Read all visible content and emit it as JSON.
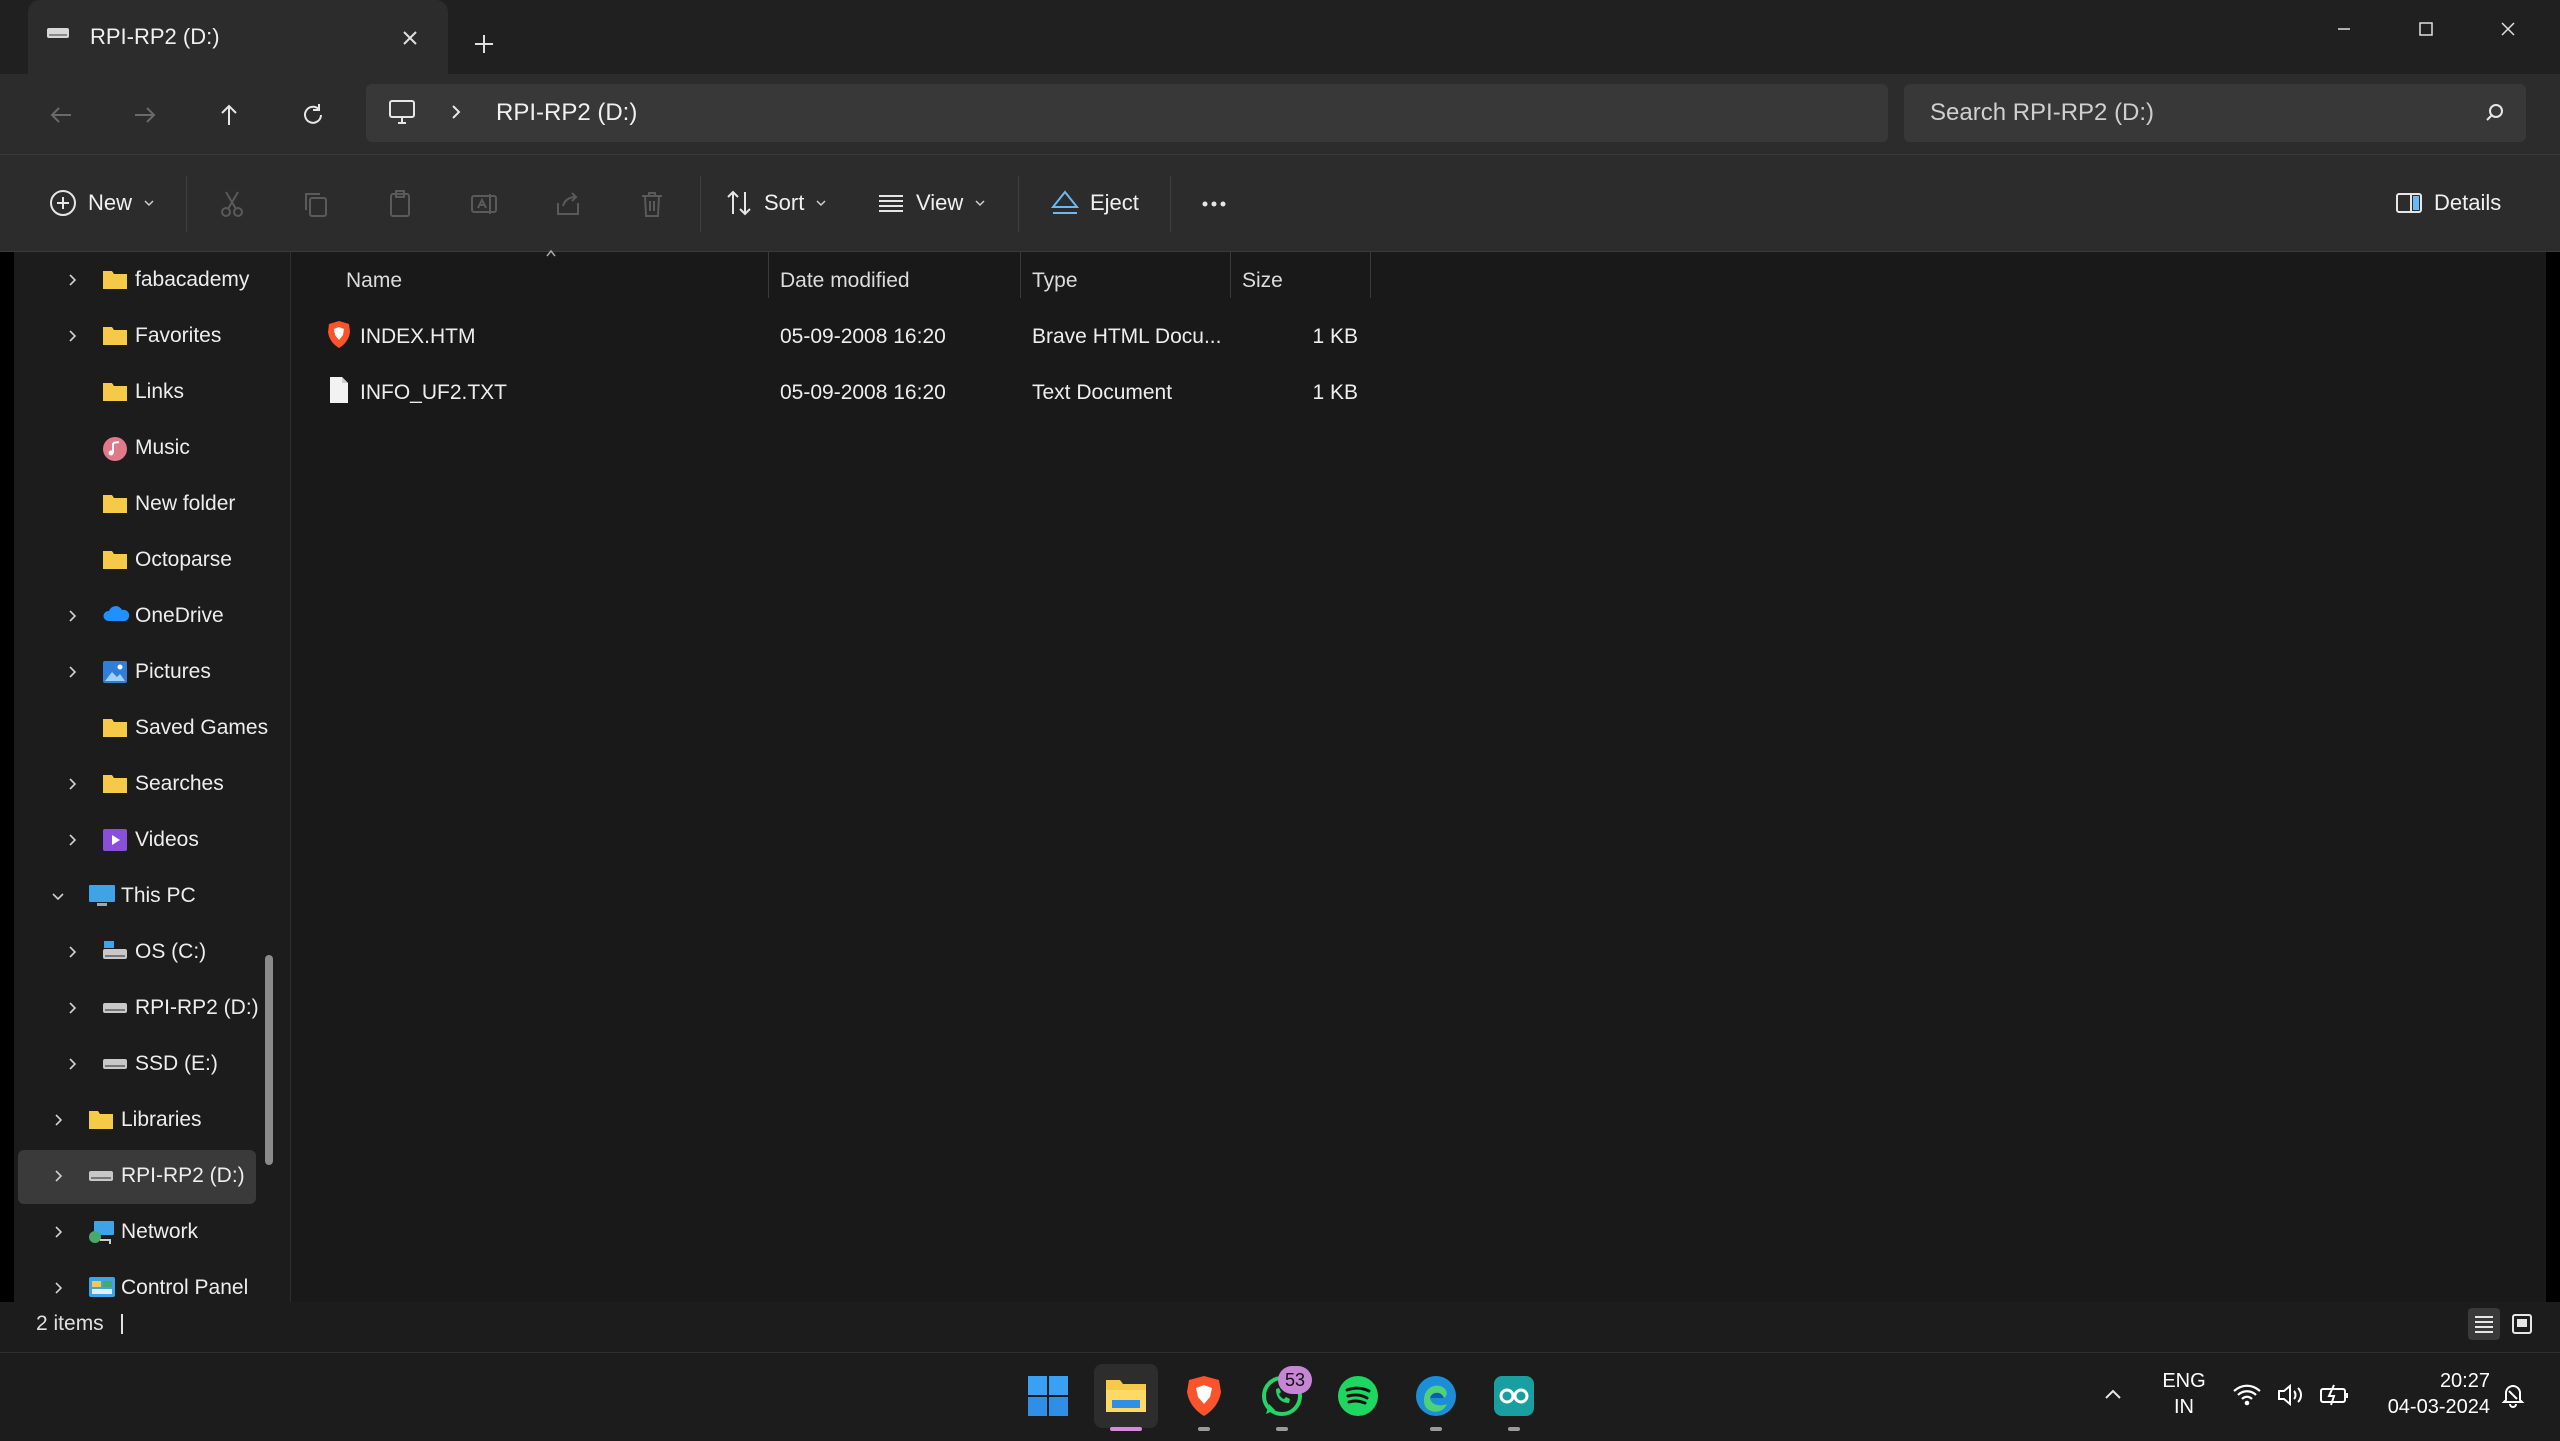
{
  "window": {
    "tab_title": "RPI-RP2 (D:)"
  },
  "address_bar": {
    "path": "RPI-RP2 (D:)",
    "search_placeholder": "Search RPI-RP2 (D:)"
  },
  "toolbar": {
    "new_label": "New",
    "sort_label": "Sort",
    "view_label": "View",
    "eject_label": "Eject",
    "details_label": "Details"
  },
  "sidebar": {
    "items": [
      {
        "label": "fabacademy",
        "icon": "folder-icon",
        "expandable": true
      },
      {
        "label": "Favorites",
        "icon": "folder-icon",
        "expandable": true
      },
      {
        "label": "Links",
        "icon": "folder-icon",
        "expandable": false
      },
      {
        "label": "Music",
        "icon": "music-icon",
        "expandable": false
      },
      {
        "label": "New folder",
        "icon": "folder-icon",
        "expandable": false
      },
      {
        "label": "Octoparse",
        "icon": "folder-icon",
        "expandable": false
      },
      {
        "label": "OneDrive",
        "icon": "onedrive-icon",
        "expandable": true
      },
      {
        "label": "Pictures",
        "icon": "pictures-icon",
        "expandable": true
      },
      {
        "label": "Saved Games",
        "icon": "folder-icon",
        "expandable": false
      },
      {
        "label": "Searches",
        "icon": "folder-icon",
        "expandable": true
      },
      {
        "label": "Videos",
        "icon": "videos-icon",
        "expandable": true
      },
      {
        "label": "This PC",
        "icon": "this-pc-icon",
        "expandable": true,
        "expanded": true
      },
      {
        "label": "OS (C:)",
        "icon": "drive-icon",
        "expandable": true
      },
      {
        "label": "RPI-RP2 (D:)",
        "icon": "drive-icon",
        "expandable": true
      },
      {
        "label": "SSD (E:)",
        "icon": "drive-icon",
        "expandable": true
      },
      {
        "label": "Libraries",
        "icon": "folder-icon",
        "expandable": true
      },
      {
        "label": "RPI-RP2 (D:)",
        "icon": "drive-icon",
        "expandable": true,
        "selected": true
      },
      {
        "label": "Network",
        "icon": "network-icon",
        "expandable": true
      },
      {
        "label": "Control Panel",
        "icon": "control-panel-icon",
        "expandable": true
      }
    ]
  },
  "file_list": {
    "columns": [
      "Name",
      "Date modified",
      "Type",
      "Size"
    ],
    "rows": [
      {
        "name": "INDEX.HTM",
        "date": "05-09-2008 16:20",
        "type": "Brave HTML Docu...",
        "size": "1 KB",
        "icon": "brave-html-icon"
      },
      {
        "name": "INFO_UF2.TXT",
        "date": "05-09-2008 16:20",
        "type": "Text Document",
        "size": "1 KB",
        "icon": "text-file-icon"
      }
    ]
  },
  "status_bar": {
    "item_count": "2 items"
  },
  "taskbar": {
    "whatsapp_badge": "53",
    "language": "ENG",
    "region": "IN",
    "time": "20:27",
    "date": "04-03-2024"
  },
  "colors": {
    "accent": "#0078d4",
    "folder": "#f7c948",
    "background": "#191919"
  }
}
